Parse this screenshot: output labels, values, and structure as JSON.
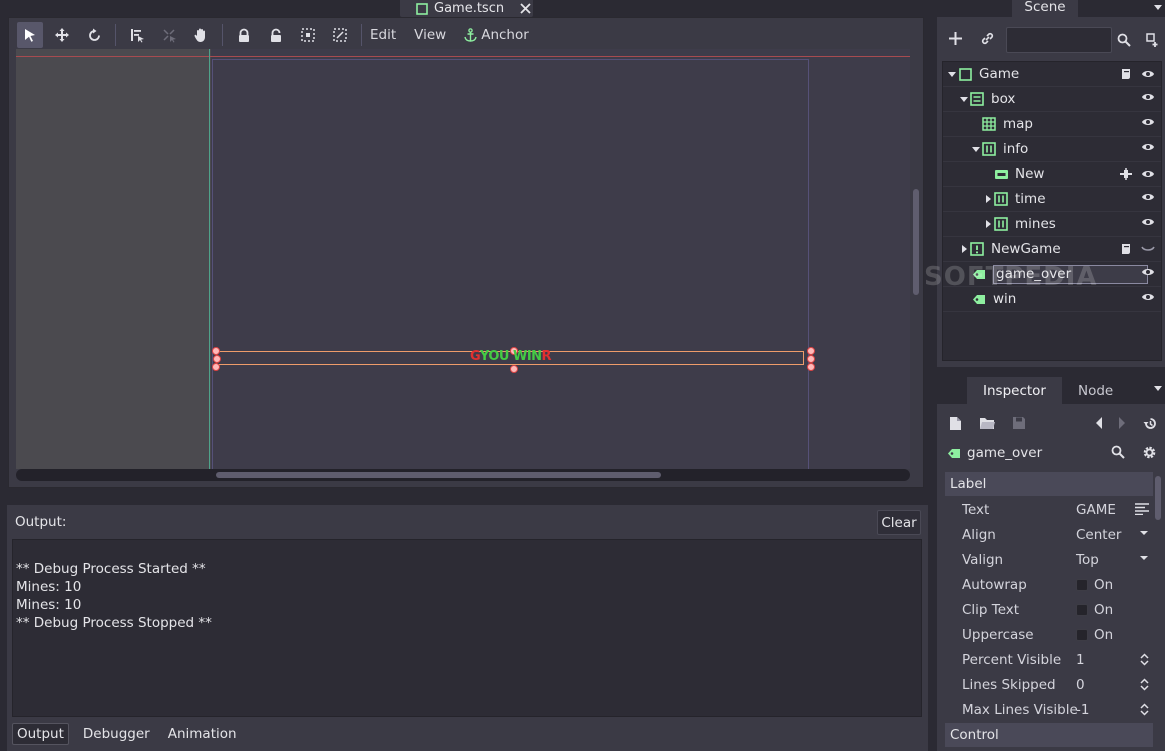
{
  "document_tab": {
    "name": "Game.tscn"
  },
  "toolbar": {
    "menus": [
      {
        "label": "Edit"
      },
      {
        "label": "View"
      },
      {
        "label": "Anchor"
      }
    ]
  },
  "canvas": {
    "label_text_prefix": "G",
    "label_text_main": "YOU WIN",
    "label_text_suffix": "R",
    "colors": {
      "win": "#44cc44",
      "over": "#e03030"
    }
  },
  "output": {
    "title": "Output:",
    "clear_label": "Clear",
    "lines": [
      "** Debug Process Started **",
      "Mines: 10",
      "Mines: 10",
      "** Debug Process Stopped **"
    ],
    "tabs": [
      {
        "label": "Output"
      },
      {
        "label": "Debugger"
      },
      {
        "label": "Animation"
      }
    ]
  },
  "scene": {
    "tab_label": "Scene",
    "filter_placeholder": "",
    "tree": [
      {
        "name": "Game"
      },
      {
        "name": "box"
      },
      {
        "name": "map"
      },
      {
        "name": "info"
      },
      {
        "name": "New"
      },
      {
        "name": "time"
      },
      {
        "name": "mines"
      },
      {
        "name": "NewGame"
      },
      {
        "name": "game_over"
      },
      {
        "name": "win"
      }
    ]
  },
  "watermark": "SOFTPEDIA",
  "inspector": {
    "tabs": [
      {
        "label": "Inspector"
      },
      {
        "label": "Node"
      }
    ],
    "node_name": "game_over",
    "sections": [
      {
        "label": "Label"
      },
      {
        "label": "Control"
      }
    ],
    "properties": [
      {
        "name": "Text",
        "value": "GAME"
      },
      {
        "name": "Align",
        "value": "Center"
      },
      {
        "name": "Valign",
        "value": "Top"
      },
      {
        "name": "Autowrap",
        "value": "On"
      },
      {
        "name": "Clip Text",
        "value": "On"
      },
      {
        "name": "Uppercase",
        "value": "On"
      },
      {
        "name": "Percent Visible",
        "value": "1"
      },
      {
        "name": "Lines Skipped",
        "value": "0"
      },
      {
        "name": "Max Lines Visible",
        "value": "-1"
      }
    ]
  }
}
